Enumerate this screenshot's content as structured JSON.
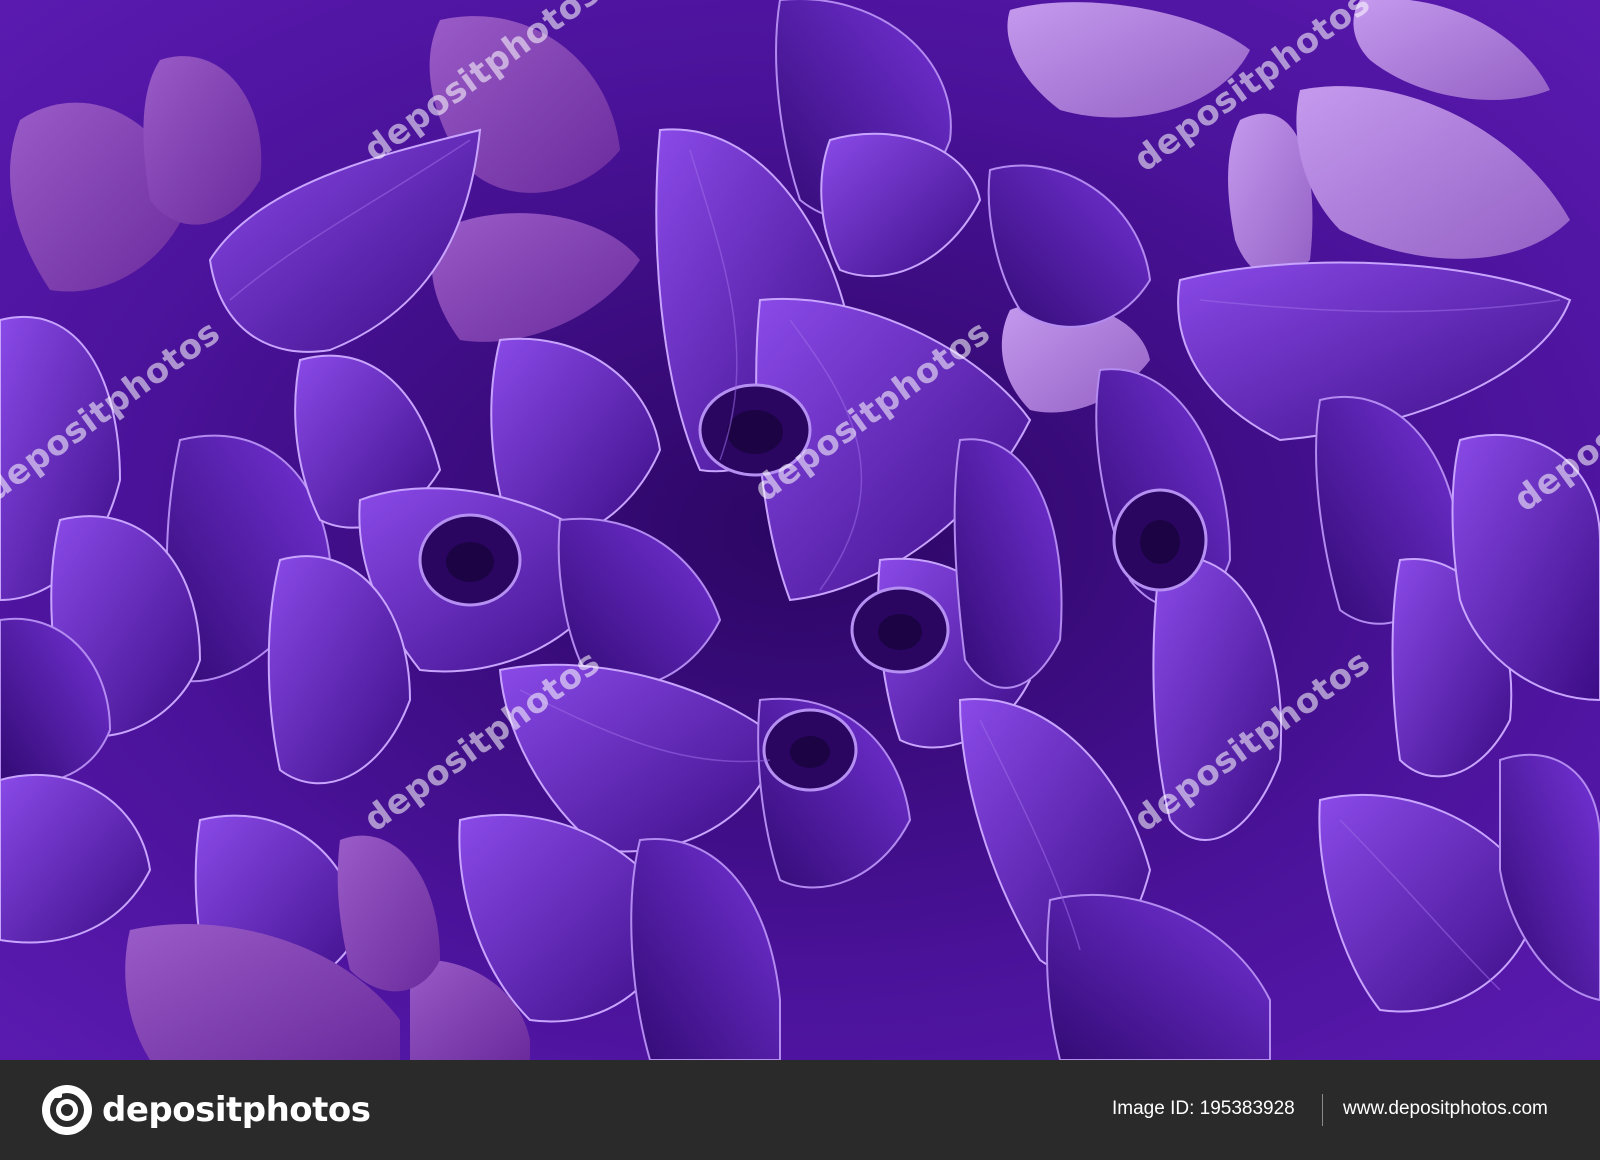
{
  "photo": {
    "subject-icon": "leaf-icon",
    "colors": {
      "deep": "#2b0663",
      "mid": "#5a17b5",
      "bright": "#7a3ae0",
      "highlight": "#b98af5",
      "pinkish": "#a46ad0"
    },
    "watermark_text": "depositphotos"
  },
  "footer": {
    "logo_text": "depositphotos",
    "image_id": "Image ID: 195383928",
    "site_url": "www.depositphotos.com"
  }
}
